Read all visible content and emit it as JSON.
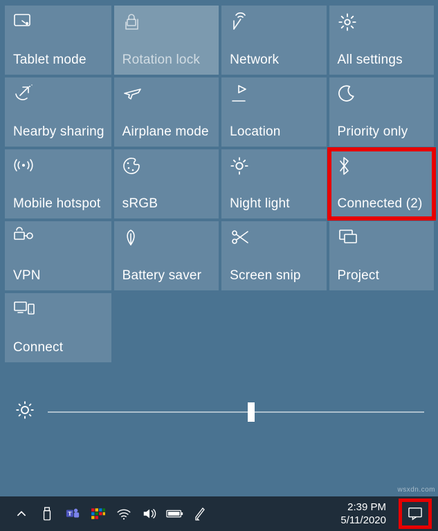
{
  "tiles": [
    {
      "id": "tablet-mode",
      "label": "Tablet mode",
      "icon": "tablet-icon"
    },
    {
      "id": "rotation-lock",
      "label": "Rotation lock",
      "icon": "rotation-lock-icon",
      "dim": true
    },
    {
      "id": "network",
      "label": "Network",
      "icon": "wifi-antenna-icon"
    },
    {
      "id": "all-settings",
      "label": "All settings",
      "icon": "gear-icon"
    },
    {
      "id": "nearby-sharing",
      "label": "Nearby sharing",
      "icon": "share-icon"
    },
    {
      "id": "airplane-mode",
      "label": "Airplane mode",
      "icon": "airplane-icon"
    },
    {
      "id": "location",
      "label": "Location",
      "icon": "location-icon"
    },
    {
      "id": "priority-only",
      "label": "Priority only",
      "icon": "moon-icon"
    },
    {
      "id": "mobile-hotspot",
      "label": "Mobile hotspot",
      "icon": "hotspot-icon"
    },
    {
      "id": "srgb",
      "label": "sRGB",
      "icon": "palette-icon"
    },
    {
      "id": "night-light",
      "label": "Night light",
      "icon": "night-light-icon"
    },
    {
      "id": "bluetooth",
      "label": "Connected (2)",
      "icon": "bluetooth-icon",
      "highlight": true
    },
    {
      "id": "vpn",
      "label": "VPN",
      "icon": "vpn-icon"
    },
    {
      "id": "battery-saver",
      "label": "Battery saver",
      "icon": "leaf-icon"
    },
    {
      "id": "screen-snip",
      "label": "Screen snip",
      "icon": "snip-icon"
    },
    {
      "id": "project",
      "label": "Project",
      "icon": "project-icon"
    },
    {
      "id": "connect",
      "label": "Connect",
      "icon": "connect-icon"
    }
  ],
  "brightness": {
    "value": 54
  },
  "taskbar": {
    "time": "2:39 PM",
    "date": "5/11/2020"
  },
  "watermark": "wsxdn.com"
}
